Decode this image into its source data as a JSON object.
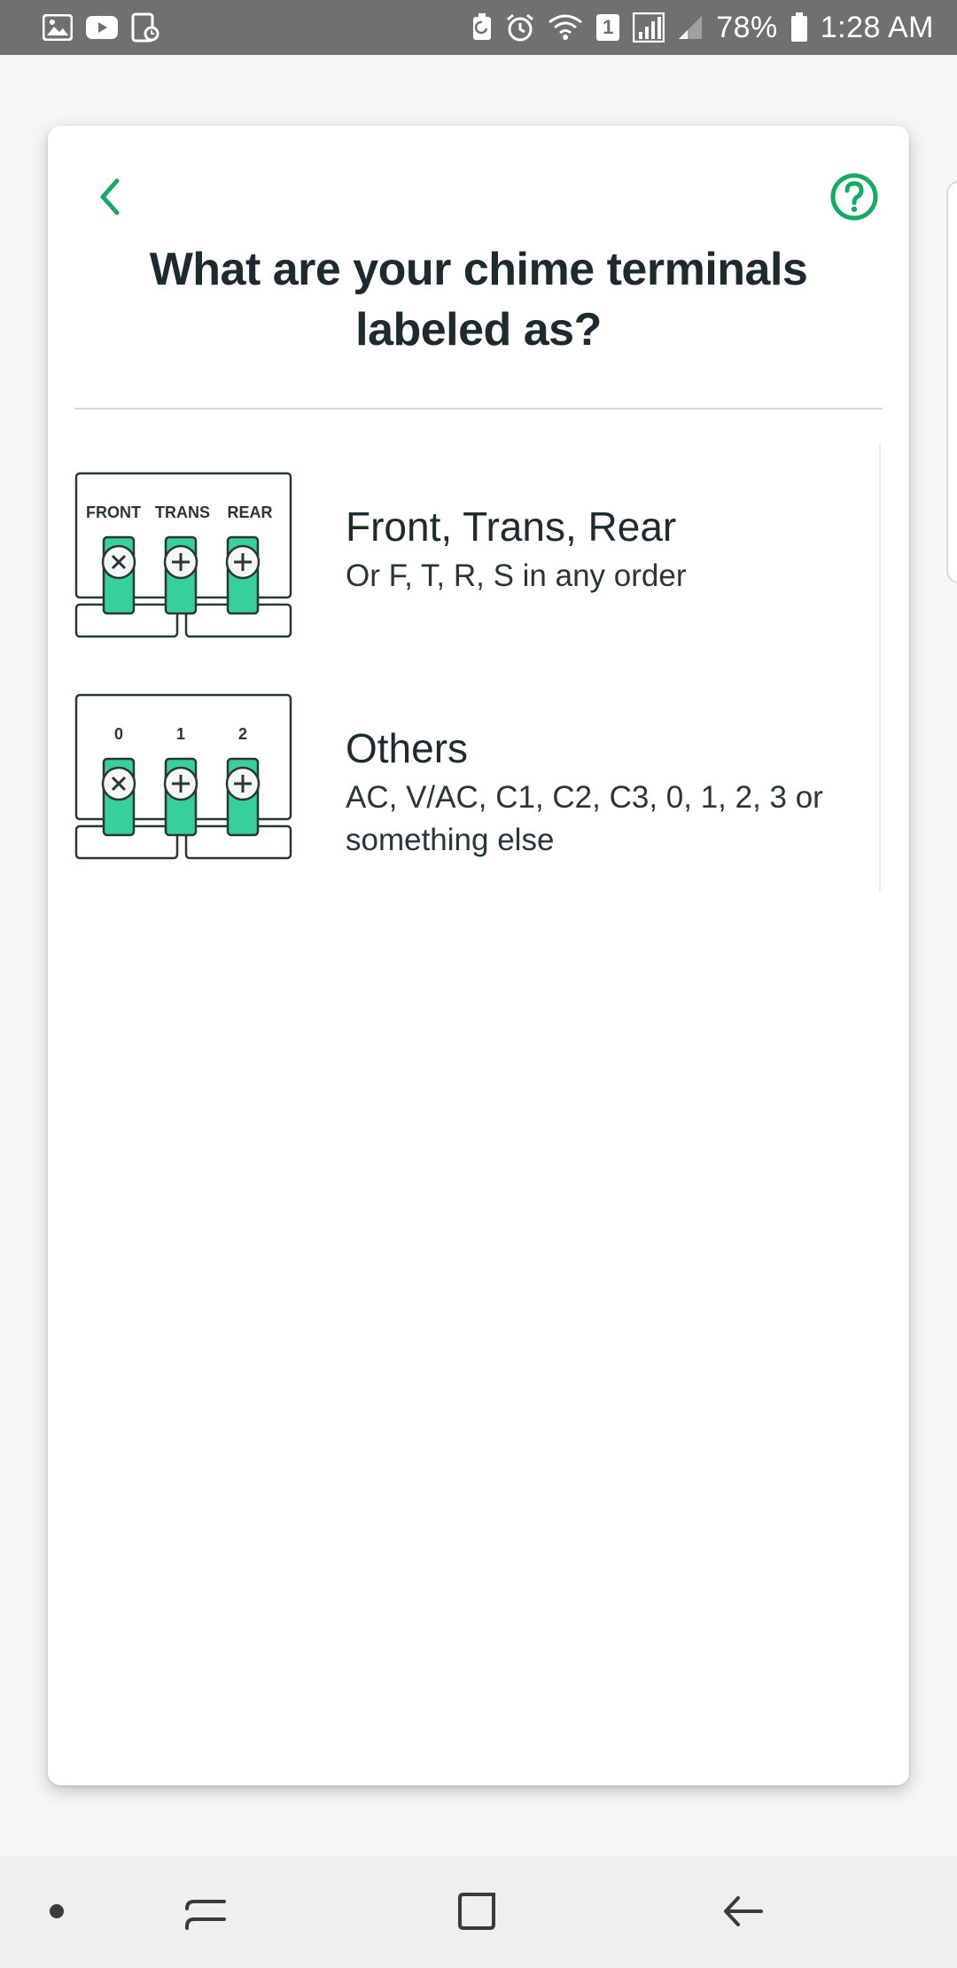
{
  "status_bar": {
    "battery_percent": "78%",
    "time": "1:28 AM",
    "sim_badge": "1",
    "icons": [
      "gallery-icon",
      "youtube-icon",
      "screenshot-icon",
      "battery-saver-icon",
      "alarm-icon",
      "wifi-icon",
      "sim-icon",
      "signal-icon",
      "signal-weak-icon",
      "battery-icon"
    ]
  },
  "page": {
    "title": "What are your chime terminals labeled as?"
  },
  "options": [
    {
      "title": "Front, Trans, Rear",
      "subtitle": "Or F, T, R, S in any order",
      "terminal_labels": [
        "FRONT",
        "TRANS",
        "REAR"
      ]
    },
    {
      "title": "Others",
      "subtitle": "AC, V/AC, C1, C2, C3, 0, 1, 2, 3 or something else",
      "terminal_labels": [
        "0",
        "1",
        "2"
      ]
    }
  ],
  "colors": {
    "accent": "#1aa867",
    "terminal_fill": "#37cf9a",
    "outline": "#2a3538"
  },
  "nav_bar": {
    "icons": [
      "dot-icon",
      "recent-apps-icon",
      "home-icon",
      "back-icon"
    ]
  }
}
